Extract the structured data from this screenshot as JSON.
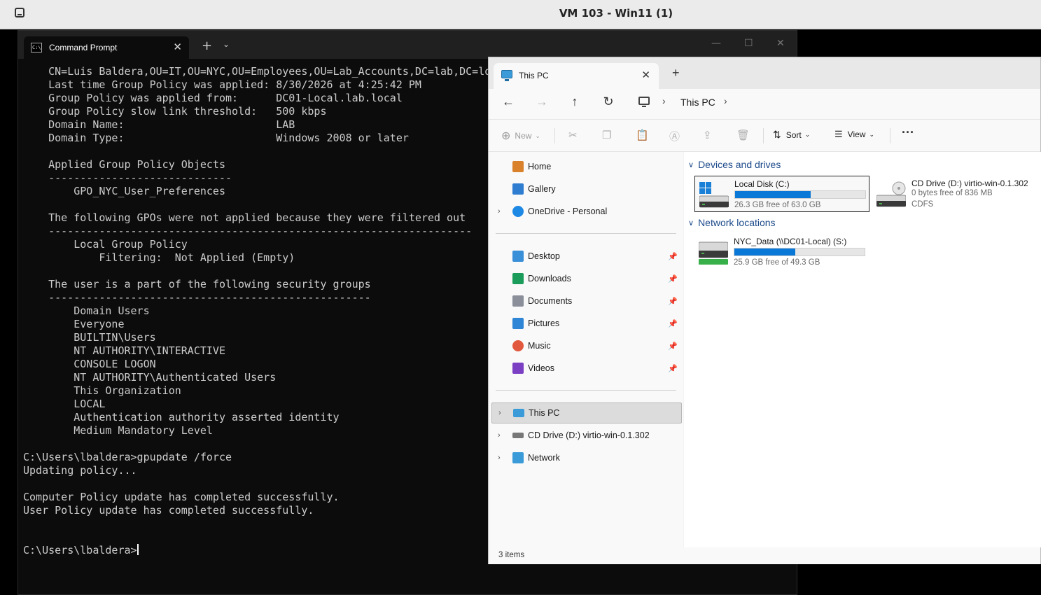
{
  "vm": {
    "title": "VM 103 - Win11 (1)"
  },
  "terminal": {
    "tab_title": "Command Prompt",
    "tab_icon_text": "C:\\",
    "lines": [
      "    CN=Luis Baldera,OU=IT,OU=NYC,OU=Employees,OU=Lab_Accounts,DC=lab,DC=local",
      "    Last time Group Policy was applied: 8/30/2026 at 4:25:42 PM",
      "    Group Policy was applied from:      DC01-Local.lab.local",
      "    Group Policy slow link threshold:   500 kbps",
      "    Domain Name:                        LAB",
      "    Domain Type:                        Windows 2008 or later",
      "",
      "    Applied Group Policy Objects",
      "    -----------------------------",
      "        GPO_NYC_User_Preferences",
      "",
      "    The following GPOs were not applied because they were filtered out",
      "    -------------------------------------------------------------------",
      "        Local Group Policy",
      "            Filtering:  Not Applied (Empty)",
      "",
      "    The user is a part of the following security groups",
      "    ---------------------------------------------------",
      "        Domain Users",
      "        Everyone",
      "        BUILTIN\\Users",
      "        NT AUTHORITY\\INTERACTIVE",
      "        CONSOLE LOGON",
      "        NT AUTHORITY\\Authenticated Users",
      "        This Organization",
      "        LOCAL",
      "        Authentication authority asserted identity",
      "        Medium Mandatory Level",
      "",
      "C:\\Users\\lbaldera>gpupdate /force",
      "Updating policy...",
      "",
      "Computer Policy update has completed successfully.",
      "User Policy update has completed successfully.",
      "",
      "",
      "C:\\Users\\lbaldera>"
    ]
  },
  "explorer": {
    "tab_title": "This PC",
    "address": {
      "crumb": "This PC"
    },
    "command_bar": {
      "new_label": "New",
      "sort_label": "Sort",
      "view_label": "View"
    },
    "nav": {
      "quick": [
        {
          "label": "Home",
          "color": "#d9822b"
        },
        {
          "label": "Gallery",
          "color": "#2e7dd1"
        },
        {
          "label": "OneDrive - Personal",
          "color": "#1e88e5"
        }
      ],
      "pinned": [
        {
          "label": "Desktop",
          "color": "#3a8fd9"
        },
        {
          "label": "Downloads",
          "color": "#1c9c5a"
        },
        {
          "label": "Documents",
          "color": "#8a8f99"
        },
        {
          "label": "Pictures",
          "color": "#2f86d6"
        },
        {
          "label": "Music",
          "color": "#e2583e"
        },
        {
          "label": "Videos",
          "color": "#7b3fc4"
        }
      ],
      "locations": [
        {
          "label": "This PC",
          "color": "#3b9bd8"
        },
        {
          "label": "CD Drive (D:) virtio-win-0.1.302",
          "color": "#777777"
        },
        {
          "label": "Network",
          "color": "#3b9bd8"
        }
      ]
    },
    "groups": {
      "devices": "Devices and drives",
      "network": "Network locations"
    },
    "drives": {
      "c": {
        "name": "Local Disk (C:)",
        "free": "26.3 GB free of 63.0 GB",
        "used_fraction": 0.58
      },
      "d": {
        "name": "CD Drive (D:) virtio-win-0.1.302",
        "free": "0 bytes free of 836 MB",
        "fs": "CDFS"
      },
      "s": {
        "name": "NYC_Data (\\\\DC01-Local) (S:)",
        "free": "25.9 GB free of 49.3 GB",
        "used_fraction": 0.47
      }
    },
    "status": "3 items"
  },
  "colors": {
    "accent": "#0a78d7",
    "group_header": "#1c4a8a",
    "terminal_bg": "#0c0c0c"
  }
}
